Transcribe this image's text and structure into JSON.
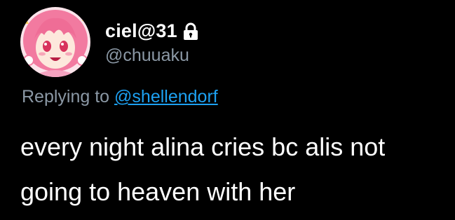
{
  "tweet": {
    "author": {
      "display_name": "ciel@31",
      "handle": "@chuuaku",
      "protected_icon": "lock-icon",
      "avatar_icon": "anime-avatar"
    },
    "reply": {
      "prefix": "Replying to",
      "mention": "@shellendorf"
    },
    "text_line_1": "every night alina cries bc alis not",
    "text_line_2": "going to heaven with her"
  },
  "colors": {
    "background": "#000000",
    "primary_text": "#ffffff",
    "secondary_text": "#8b98a5",
    "link": "#1da1f2",
    "avatar_bg": "#fbe3ea",
    "avatar_hair": "#f27aa0"
  }
}
